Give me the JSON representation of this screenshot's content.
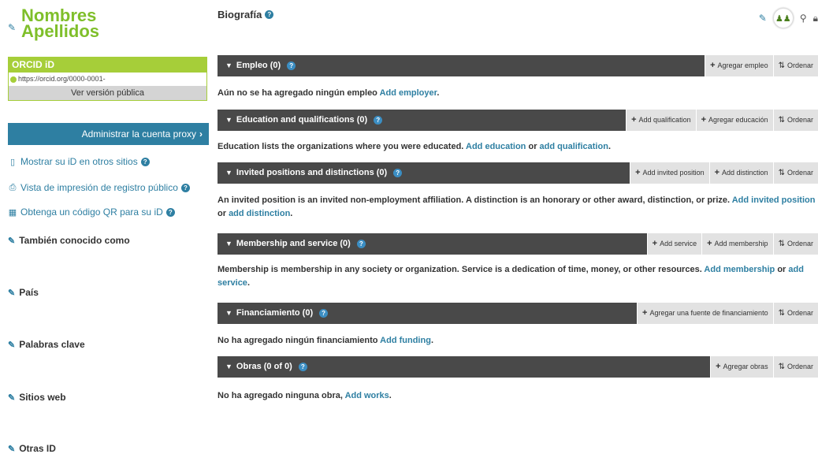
{
  "profile": {
    "name_line1": "Nombres",
    "name_line2": "Apellidos",
    "orcid_header": "ORCID iD",
    "orcid_url": "https://orcid.org/0000-0001-",
    "public_version": "Ver versión pública"
  },
  "sidebar": {
    "proxy_button": "Administrar la cuenta proxy",
    "links": [
      {
        "label": "Mostrar su iD en otros sitios",
        "icon": "mobile-icon"
      },
      {
        "label": "Vista de impresión de registro público",
        "icon": "print-icon"
      },
      {
        "label": "Obtenga un código QR para su iD",
        "icon": "qr-code-icon"
      }
    ],
    "fields": [
      "También conocido como",
      "País",
      "Palabras clave",
      "Sitios web",
      "Otras ID"
    ]
  },
  "main": {
    "bio_title": "Biografía",
    "sections": [
      {
        "title": "Empleo (0)",
        "buttons": [
          "Agregar empleo",
          "Ordenar"
        ],
        "text": "Aún no se ha agregado ningún empleo",
        "links": [
          "Add employer"
        ],
        "connectors": [
          "."
        ]
      },
      {
        "title": "Education and qualifications (0)",
        "buttons": [
          "Add qualification",
          "Agregar educación",
          "Ordenar"
        ],
        "text": "Education lists the organizations where you were educated.",
        "links": [
          "Add education",
          "add qualification"
        ],
        "connectors": [
          "or",
          "."
        ]
      },
      {
        "title": "Invited positions and distinctions (0)",
        "buttons": [
          "Add invited position",
          "Add distinction",
          "Ordenar"
        ],
        "text": "An invited position is an invited non-employment affiliation. A distinction is an honorary or other award, distinction, or prize.",
        "links": [
          "Add invited position",
          "add distinction"
        ],
        "connectors": [
          "or",
          "."
        ]
      },
      {
        "title": "Membership and service (0)",
        "buttons": [
          "Add service",
          "Add membership",
          "Ordenar"
        ],
        "text": "Membership is membership in any society or organization. Service is a dedication of time, money, or other resources.",
        "links": [
          "Add membership",
          "add service"
        ],
        "connectors": [
          "or",
          "."
        ]
      },
      {
        "title": "Financiamiento (0)",
        "buttons": [
          "Agregar una fuente de financiamiento",
          "Ordenar"
        ],
        "text": "No ha agregado ningún financiamiento",
        "links": [
          "Add funding"
        ],
        "connectors": [
          "."
        ]
      },
      {
        "title": "Obras (0 of 0)",
        "buttons": [
          "Agregar obras",
          "Ordenar"
        ],
        "text": "No ha agregado ninguna obra,",
        "links": [
          "Add works"
        ],
        "connectors": [
          "."
        ]
      }
    ]
  },
  "colors": {
    "orcid_green": "#a6ce39",
    "name_green": "#7fbf2a",
    "link_blue": "#2e7fa2",
    "bar_dark": "#494949"
  }
}
